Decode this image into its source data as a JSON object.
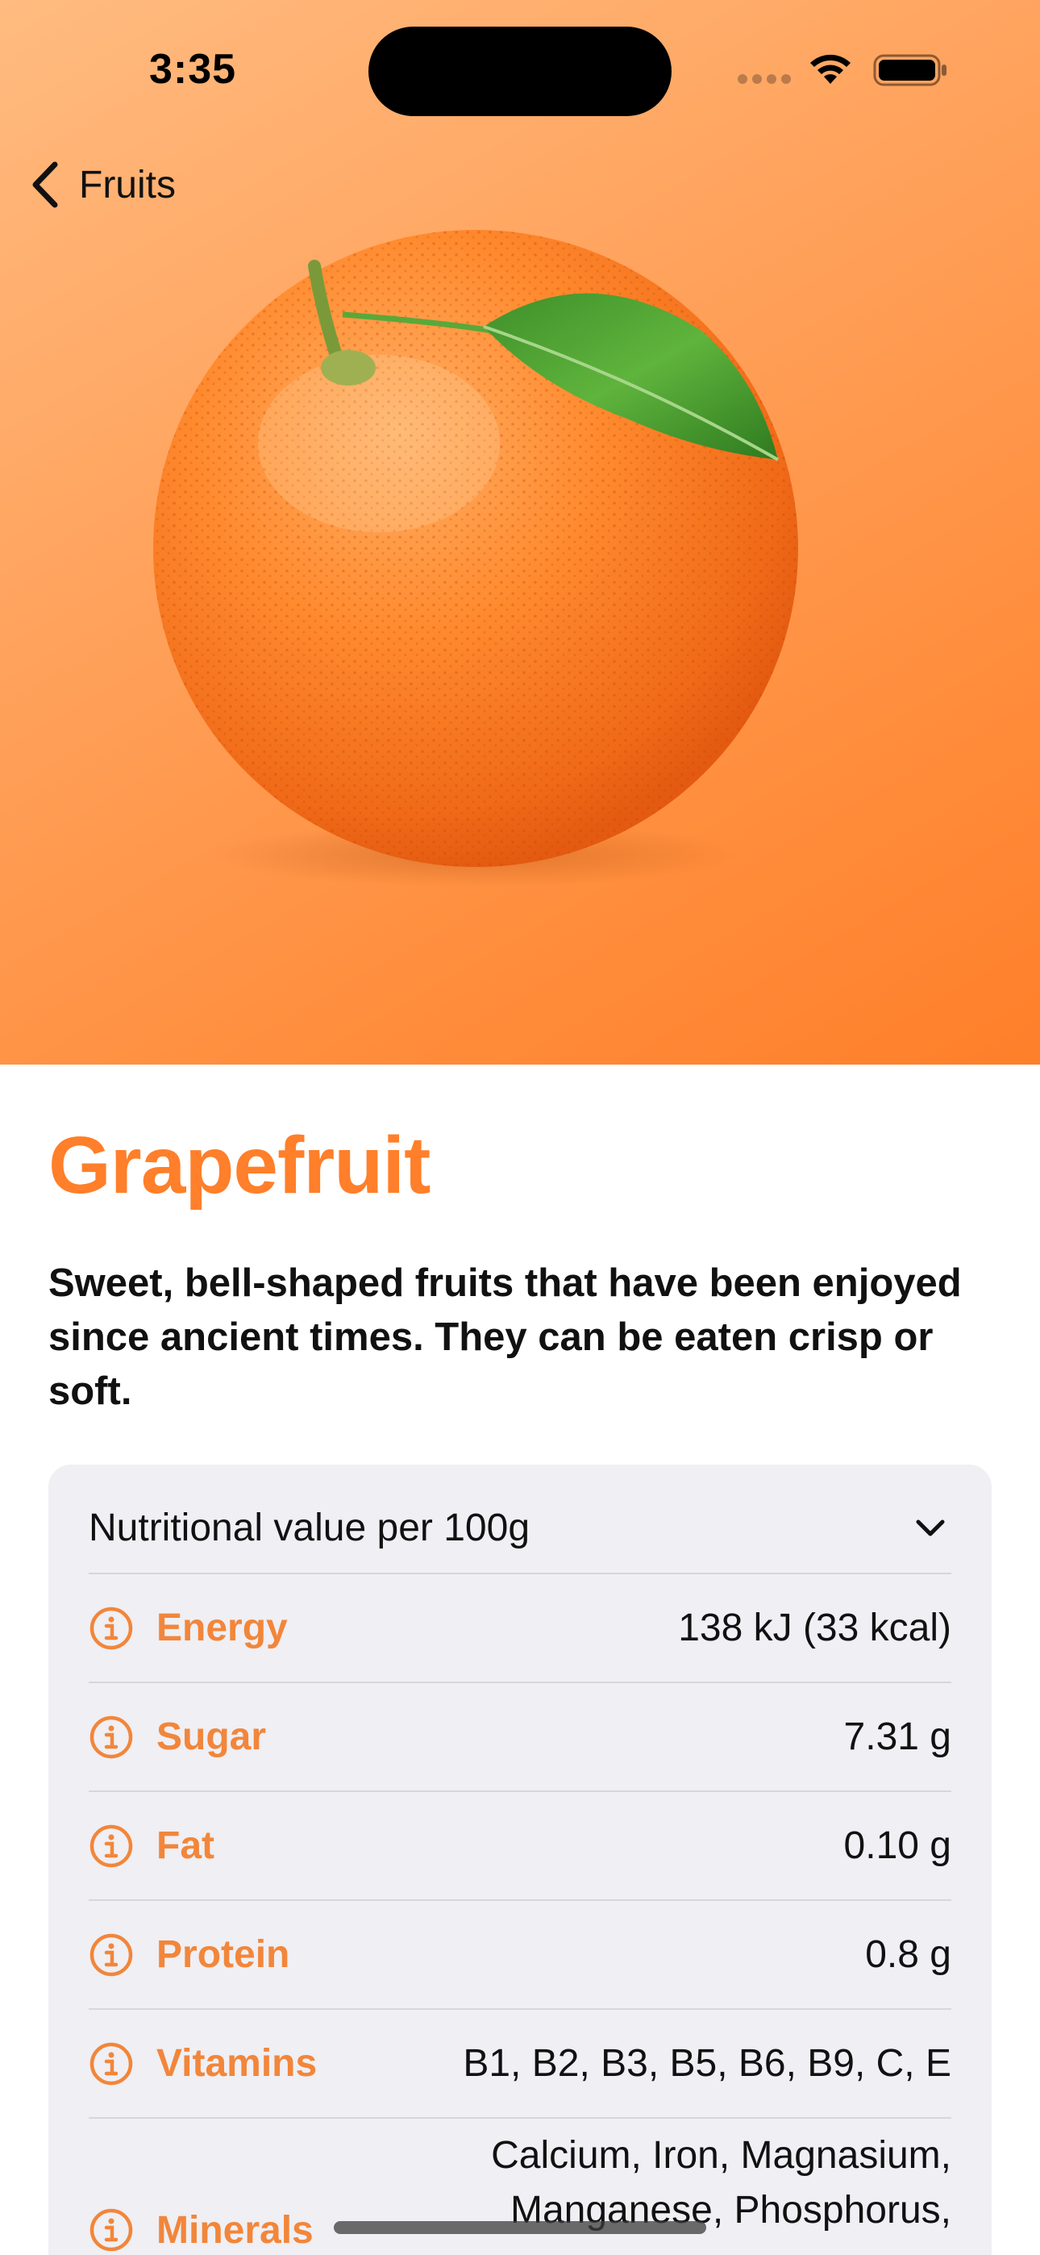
{
  "status_bar": {
    "time": "3:35"
  },
  "nav": {
    "back_label": "Fruits",
    "icon": "chevron-left-icon"
  },
  "theme": {
    "accent": "#ff7f2a",
    "label_color": "#f2863a",
    "card_bg": "#efeff4"
  },
  "fruit": {
    "name": "Grapefruit",
    "description": "Sweet, bell-shaped fruits that have been enjoyed since ancient times. They can be eaten crisp or soft."
  },
  "nutrition": {
    "header": "Nutritional value per 100g",
    "header_icon": "chevron-down-icon",
    "rows": [
      {
        "label": "Energy",
        "value": "138 kJ (33 kcal)",
        "icon": "info-icon"
      },
      {
        "label": "Sugar",
        "value": "7.31 g",
        "icon": "info-icon"
      },
      {
        "label": "Fat",
        "value": "0.10 g",
        "icon": "info-icon"
      },
      {
        "label": "Protein",
        "value": "0.8 g",
        "icon": "info-icon"
      },
      {
        "label": "Vitamins",
        "value": "B1, B2, B3, B5, B6, B9, C, E",
        "icon": "info-icon"
      },
      {
        "label": "Minerals",
        "value_lines": [
          "Calcium, Iron, Magnasium,",
          "Manganese, Phosphorus,"
        ],
        "icon": "info-icon"
      }
    ]
  }
}
